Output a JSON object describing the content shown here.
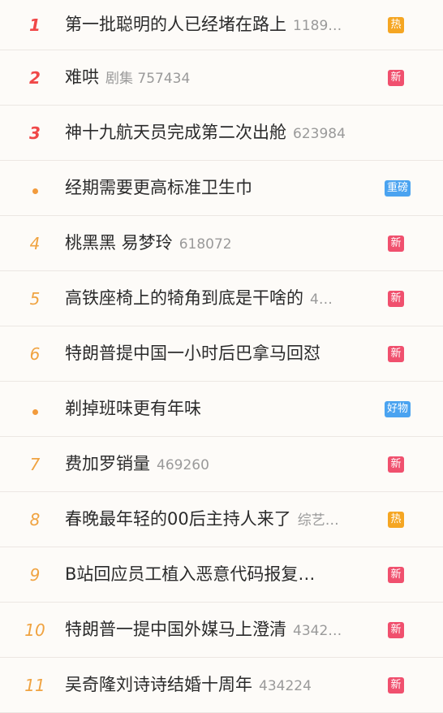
{
  "colors": {
    "rank_top": "#f04848",
    "rank_other": "#f0a341",
    "dot": "#f29b3c",
    "badge_hot": "#f5a623",
    "badge_new": "#f0506e",
    "badge_heavy": "#4aa3f0",
    "badge_good": "#4aa3f0"
  },
  "rows": [
    {
      "rank": "1",
      "rank_style": "top",
      "title": "第一批聪明的人已经堵在路上",
      "meta": "1189…",
      "badge": "热",
      "badge_color": "#f5a623"
    },
    {
      "rank": "2",
      "rank_style": "top",
      "title": "难哄",
      "meta": "剧集 757434",
      "badge": "新",
      "badge_color": "#f0506e"
    },
    {
      "rank": "3",
      "rank_style": "top",
      "title": "神十九航天员完成第二次出舱",
      "meta": "623984",
      "badge": "",
      "badge_color": ""
    },
    {
      "rank": "",
      "rank_style": "dot",
      "title": "经期需要更高标准卫生巾",
      "meta": "",
      "badge": "重磅",
      "badge_color": "#4aa3f0"
    },
    {
      "rank": "4",
      "rank_style": "mid",
      "title": "桃黑黑 易梦玲",
      "meta": "618072",
      "badge": "新",
      "badge_color": "#f0506e"
    },
    {
      "rank": "5",
      "rank_style": "mid",
      "title": "高铁座椅上的犄角到底是干啥的",
      "meta": "4…",
      "badge": "新",
      "badge_color": "#f0506e"
    },
    {
      "rank": "6",
      "rank_style": "mid",
      "title": "特朗普提中国一小时后巴拿马回怼",
      "meta": "",
      "badge": "新",
      "badge_color": "#f0506e"
    },
    {
      "rank": "",
      "rank_style": "dot",
      "title": "剃掉班味更有年味",
      "meta": "",
      "badge": "好物",
      "badge_color": "#4aa3f0"
    },
    {
      "rank": "7",
      "rank_style": "mid",
      "title": "费加罗销量",
      "meta": "469260",
      "badge": "新",
      "badge_color": "#f0506e"
    },
    {
      "rank": "8",
      "rank_style": "mid",
      "title": "春晚最年轻的00后主持人来了",
      "meta": "综艺…",
      "badge": "热",
      "badge_color": "#f5a623"
    },
    {
      "rank": "9",
      "rank_style": "mid",
      "title": "B站回应员工植入恶意代码报复…",
      "meta": "",
      "badge": "新",
      "badge_color": "#f0506e"
    },
    {
      "rank": "10",
      "rank_style": "mid",
      "title": "特朗普一提中国外媒马上澄清",
      "meta": "4342…",
      "badge": "新",
      "badge_color": "#f0506e"
    },
    {
      "rank": "11",
      "rank_style": "mid",
      "title": "吴奇隆刘诗诗结婚十周年",
      "meta": "434224",
      "badge": "新",
      "badge_color": "#f0506e"
    }
  ]
}
